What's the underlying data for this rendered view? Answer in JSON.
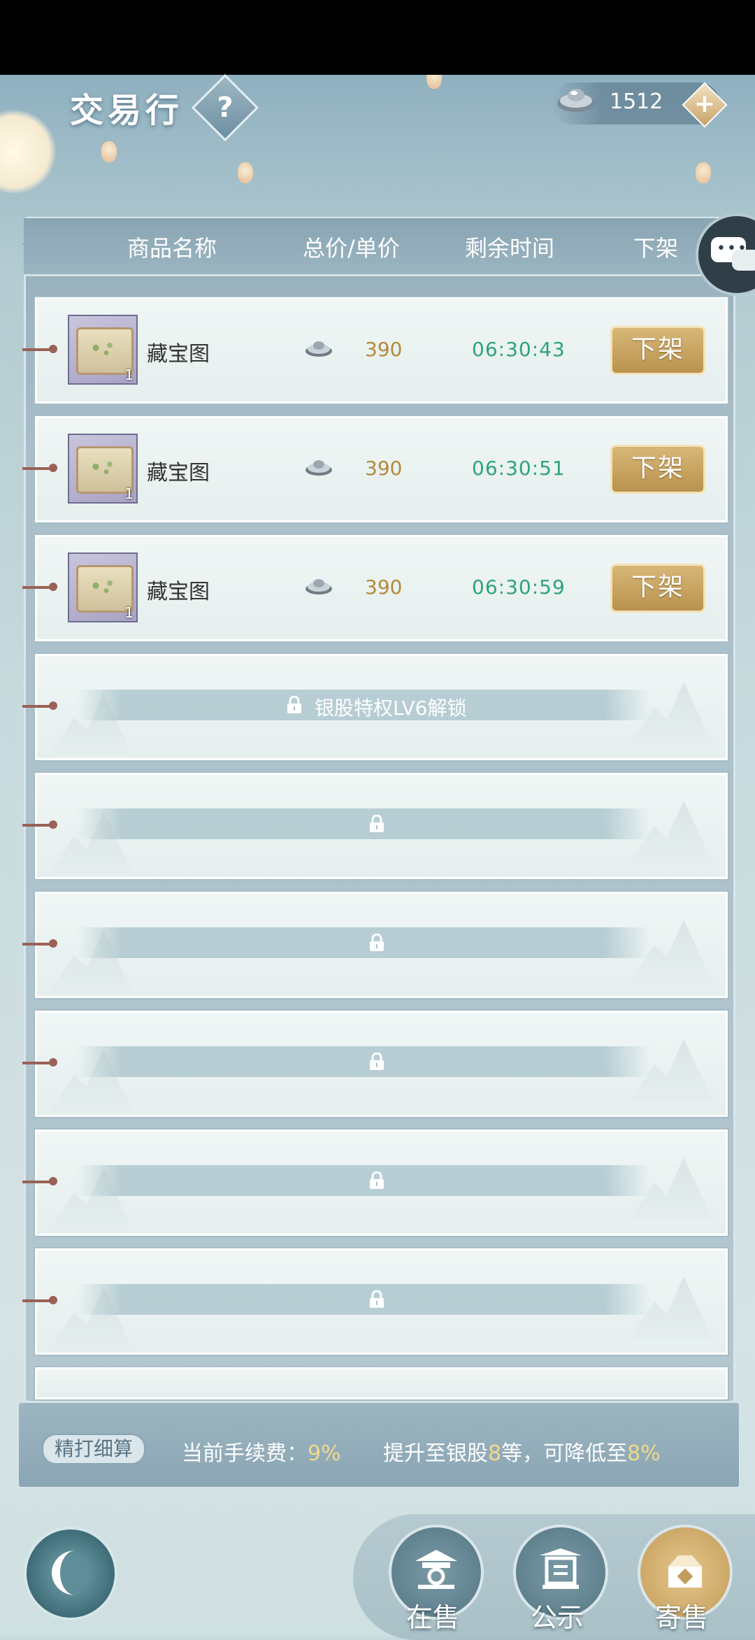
{
  "header": {
    "title": "交易行",
    "help_label": "?"
  },
  "currency": {
    "icon": "silver-ingot-icon",
    "value": "1512",
    "add_label": "+"
  },
  "columns": {
    "name": "商品名称",
    "price": "总价/单价",
    "time": "剩余时间",
    "delist": "下架"
  },
  "listings": [
    {
      "name": "藏宝图",
      "qty": "1",
      "price": "390",
      "time": "06:30:43",
      "action": "下架"
    },
    {
      "name": "藏宝图",
      "qty": "1",
      "price": "390",
      "time": "06:30:51",
      "action": "下架"
    },
    {
      "name": "藏宝图",
      "qty": "1",
      "price": "390",
      "time": "06:30:59",
      "action": "下架"
    }
  ],
  "locked_slots": [
    {
      "text": "银股特权LV6解锁"
    },
    {
      "text": ""
    },
    {
      "text": ""
    },
    {
      "text": ""
    },
    {
      "text": ""
    },
    {
      "text": ""
    }
  ],
  "tip": {
    "badge": "精打细算",
    "fee_label": "当前手续费：",
    "fee_value": "9%",
    "upgrade_prefix": "提升至银股",
    "upgrade_level": "8",
    "upgrade_mid": "等，可降低至",
    "upgrade_value": "8%"
  },
  "nav": {
    "on_sale": "在售",
    "public": "公示",
    "consign": "寄售"
  },
  "colors": {
    "price": "#b48a3a",
    "time": "#2fa37a",
    "accent": "#f2d98a"
  }
}
